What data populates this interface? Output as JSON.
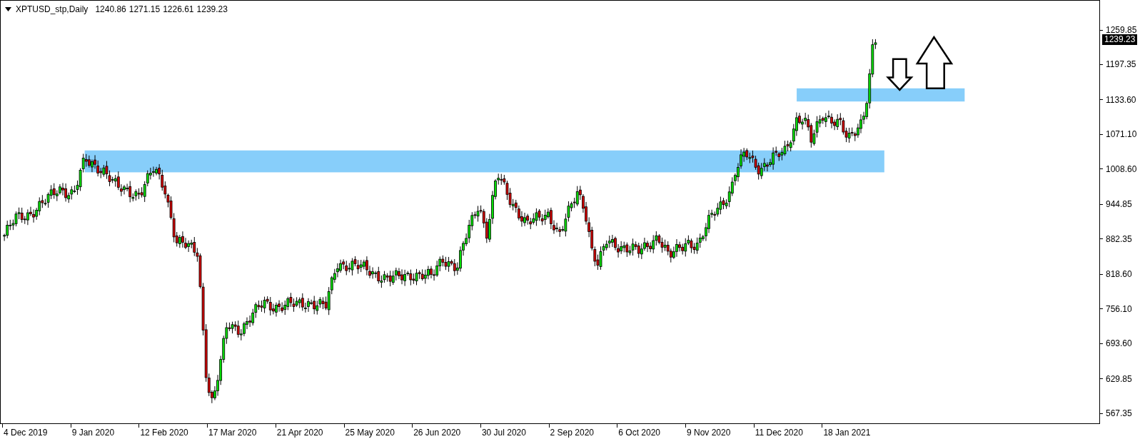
{
  "header": {
    "symbol": "XPTUSD_stp,Daily",
    "ohlc": [
      "1240.86",
      "1271.15",
      "1226.61",
      "1239.23"
    ]
  },
  "price_axis": {
    "labels": [
      "1259.85",
      "1197.35",
      "1133.60",
      "1071.10",
      "1008.60",
      "944.85",
      "882.35",
      "818.60",
      "756.10",
      "693.60",
      "629.85",
      "567.35"
    ],
    "current_price": "1239.23"
  },
  "time_axis": {
    "labels": [
      "4 Dec 2019",
      "9 Jan 2020",
      "12 Feb 2020",
      "17 Mar 2020",
      "21 Apr 2020",
      "25 May 2020",
      "26 Jun 2020",
      "30 Jul 2020",
      "2 Sep 2020",
      "6 Oct 2020",
      "9 Nov 2020",
      "11 Dec 2020",
      "18 Jan 2021"
    ]
  }
}
